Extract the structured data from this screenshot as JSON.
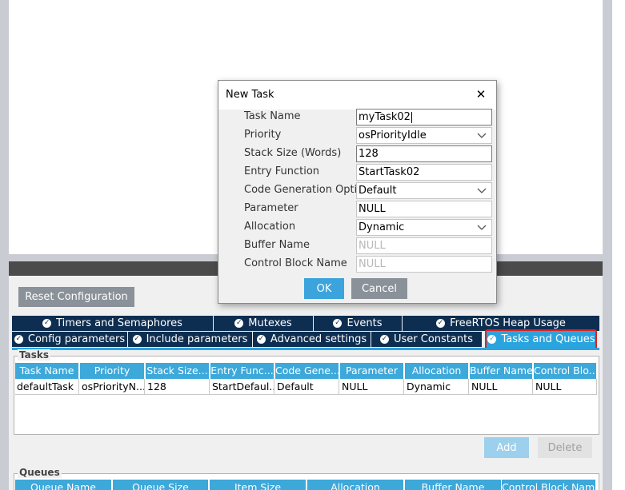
{
  "reset_button": "Reset Configuration",
  "tabs_row1": [
    {
      "label": "Timers and Semaphores"
    },
    {
      "label": "Mutexes"
    },
    {
      "label": "Events"
    },
    {
      "label": "FreeRTOS Heap Usage"
    }
  ],
  "tabs_row2": [
    {
      "label": "Config parameters"
    },
    {
      "label": "Include parameters"
    },
    {
      "label": "Advanced settings"
    },
    {
      "label": "User Constants"
    },
    {
      "label": "Tasks and Queues"
    }
  ],
  "tasks_section": {
    "title": "Tasks",
    "columns": [
      "Task Name",
      "Priority",
      "Stack Size...",
      "Entry Func...",
      "Code Gene...",
      "Parameter",
      "Allocation",
      "Buffer Name",
      "Control Blo..."
    ],
    "rows": [
      [
        "defaultTask",
        "osPriorityN...",
        "128",
        "StartDefaul...",
        "Default",
        "NULL",
        "Dynamic",
        "NULL",
        "NULL"
      ]
    ],
    "add_label": "Add",
    "delete_label": "Delete"
  },
  "queues_section": {
    "title": "Queues",
    "columns": [
      "Queue Name",
      "Queue Size",
      "Item Size",
      "Allocation",
      "Buffer Name",
      "Control Block Name"
    ]
  },
  "dialog": {
    "title": "New Task",
    "close_glyph": "✕",
    "fields": {
      "task_name": {
        "label": "Task Name",
        "value": "myTask02"
      },
      "priority": {
        "label": "Priority",
        "value": "osPriorityIdle"
      },
      "stack_size": {
        "label": "Stack Size (Words)",
        "value": "128"
      },
      "entry_function": {
        "label": "Entry Function",
        "value": "StartTask02"
      },
      "code_generation": {
        "label": "Code Generation Option",
        "value": "Default"
      },
      "parameter": {
        "label": "Parameter",
        "value": "NULL"
      },
      "allocation": {
        "label": "Allocation",
        "value": "Dynamic"
      },
      "buffer_name": {
        "label": "Buffer Name",
        "value": "NULL"
      },
      "control_block_name": {
        "label": "Control Block Name",
        "value": "NULL"
      }
    },
    "ok_label": "OK",
    "cancel_label": "Cancel"
  },
  "colors": {
    "tab_dark": "#0e2e51",
    "tab_active": "#2aa4df",
    "header_blue": "#3da8da",
    "highlight_red": "#e02020",
    "button_blue": "#3ba4dc"
  }
}
